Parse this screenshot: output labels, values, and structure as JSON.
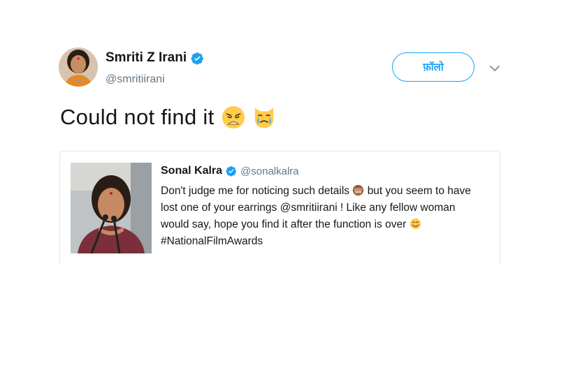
{
  "tweet": {
    "author": {
      "name": "Smriti Z Irani",
      "handle": "@smritiirani",
      "verified": true,
      "avatar_icon": "profile-photo"
    },
    "follow_label": "फ़ॉलो",
    "menu_icon": "chevron-down-icon",
    "text": "Could not find it",
    "text_emojis": [
      "weary-face-emoji",
      "crying-cat-emoji"
    ]
  },
  "quoted_tweet": {
    "author": {
      "name": "Sonal Kalra",
      "handle": "@sonalkalra",
      "verified": true
    },
    "lines": [
      {
        "before": "Don't judge me for noticing such details",
        "emoji": "see-no-evil-monkey-emoji",
        "after": "but you seem to have"
      },
      {
        "before": "lost one of your earrings @smritiirani ! Like any fellow woman",
        "emoji": "",
        "after": ""
      },
      {
        "before": "would say, hope you find it after the function is over",
        "emoji": "smiling-face-emoji",
        "after": ""
      },
      {
        "before": "#NationalFilmAwards",
        "emoji": "",
        "after": ""
      }
    ],
    "image_icon": "quoted-tweet-photo"
  },
  "colors": {
    "accent": "#1da1f2",
    "secondary_text": "#657786",
    "border": "#e1e8ed"
  }
}
